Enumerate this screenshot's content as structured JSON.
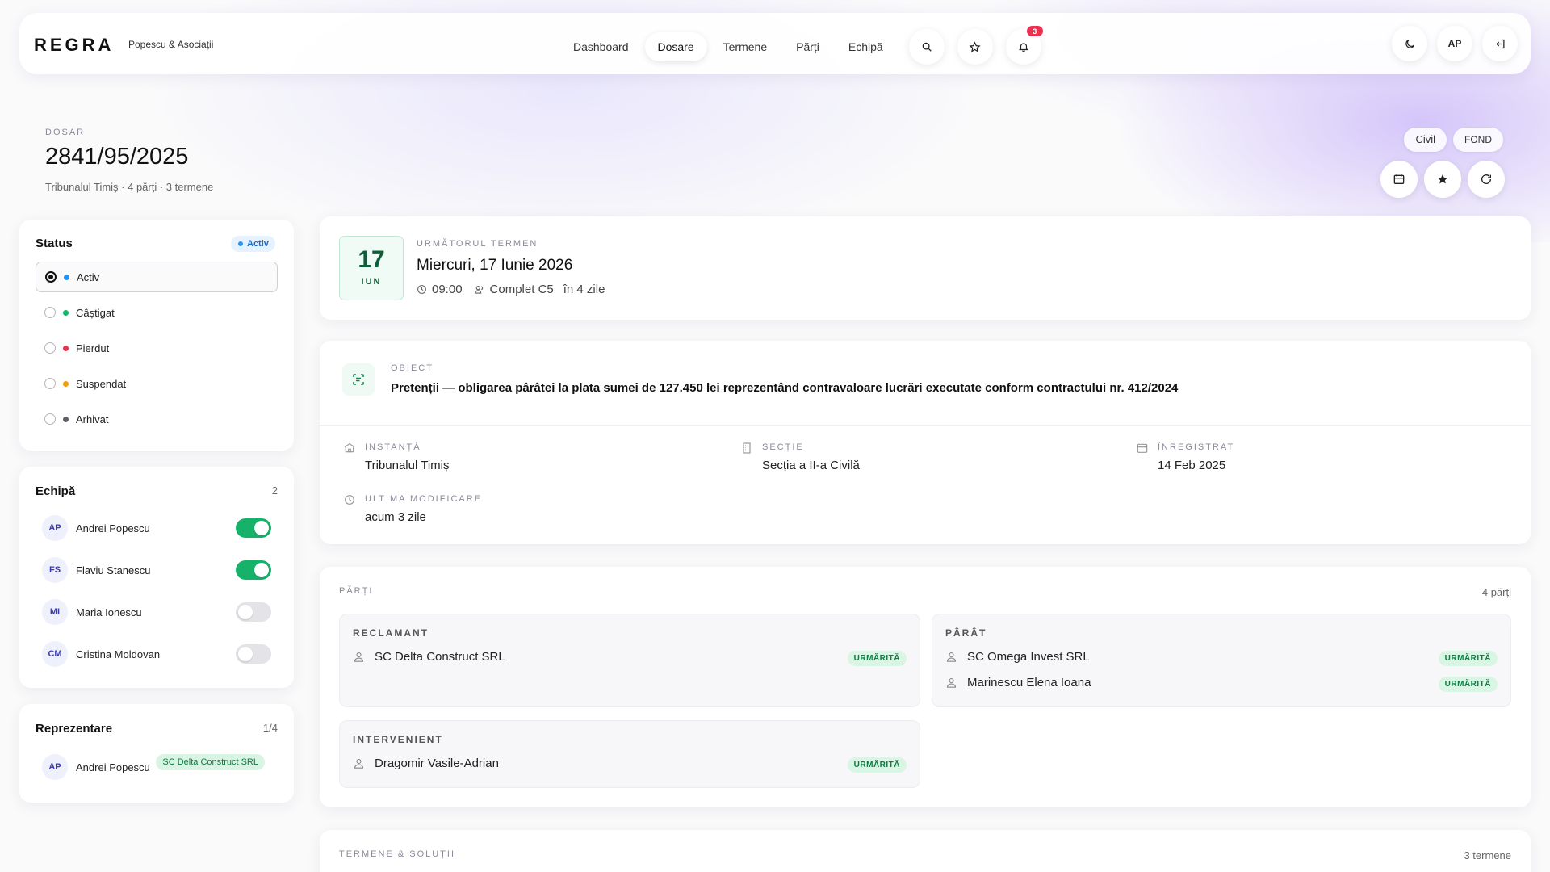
{
  "brand": {
    "logo": "REGRA",
    "firm": "Popescu & Asociații"
  },
  "nav": {
    "items": [
      {
        "label": "Dashboard",
        "active": false
      },
      {
        "label": "Dosare",
        "active": true
      },
      {
        "label": "Termene",
        "active": false
      },
      {
        "label": "Părți",
        "active": false
      },
      {
        "label": "Echipă",
        "active": false
      }
    ],
    "notifications_count": "3",
    "user_initials": "AP"
  },
  "dossier": {
    "eyebrow": "DOSAR",
    "number": "2841/95/2025",
    "subtitle": "Tribunalul Timiș · 4 părți · 3 termene",
    "tags": [
      "Civil",
      "FOND"
    ]
  },
  "status": {
    "title": "Status",
    "current": "Activ",
    "options": [
      {
        "label": "Activ",
        "color": "#2493ef",
        "selected": true
      },
      {
        "label": "Câștigat",
        "color": "#12b76a",
        "selected": false
      },
      {
        "label": "Pierdut",
        "color": "#e8324f",
        "selected": false
      },
      {
        "label": "Suspendat",
        "color": "#f59e0b",
        "selected": false
      },
      {
        "label": "Arhivat",
        "color": "#5f5f66",
        "selected": false
      }
    ]
  },
  "team": {
    "title": "Echipă",
    "count": "2",
    "members": [
      {
        "initials": "AP",
        "name": "Andrei Popescu",
        "enabled": true
      },
      {
        "initials": "FS",
        "name": "Flaviu Stanescu",
        "enabled": true
      },
      {
        "initials": "MI",
        "name": "Maria Ionescu",
        "enabled": false
      },
      {
        "initials": "CM",
        "name": "Cristina Moldovan",
        "enabled": false
      }
    ]
  },
  "representation": {
    "title": "Reprezentare",
    "count": "1/4",
    "initials": "AP",
    "name": "Andrei Popescu",
    "party": "SC Delta Construct SRL"
  },
  "next_term": {
    "label": "URMĂTORUL TERMEN",
    "day": "17",
    "month": "IUN",
    "date_text": "Miercuri, 17 Iunie 2026",
    "time": "09:00",
    "panel": "Complet C5",
    "relative": "în 4 zile"
  },
  "object": {
    "label": "OBIECT",
    "text": "Pretenții — obligarea pârâtei la plata sumei de 127.450 lei reprezentând contravaloare lucrări executate conform contractului nr. 412/2024",
    "fields": {
      "court_label": "INSTANȚĂ",
      "court": "Tribunalul Timiș",
      "section_label": "SECȚIE",
      "section": "Secția a II-a Civilă",
      "registered_label": "ÎNREGISTRAT",
      "registered": "14 Feb 2025",
      "modified_label": "ULTIMA MODIFICARE",
      "modified": "acum 3 zile"
    }
  },
  "parties": {
    "label": "PĂRȚI",
    "count": "4 părți",
    "followed_label": "URMĂRITĂ",
    "claimant_label": "RECLAMANT",
    "claimant": "SC Delta Construct SRL",
    "defendant_label": "PÂRÂT",
    "defendants": [
      "SC Omega Invest SRL",
      "Marinescu Elena Ioana"
    ],
    "intervener_label": "INTERVENIENT",
    "intervener": "Dragomir Vasile-Adrian"
  },
  "terms": {
    "label": "TERMENE & SOLUȚII",
    "count": "3 termene"
  }
}
